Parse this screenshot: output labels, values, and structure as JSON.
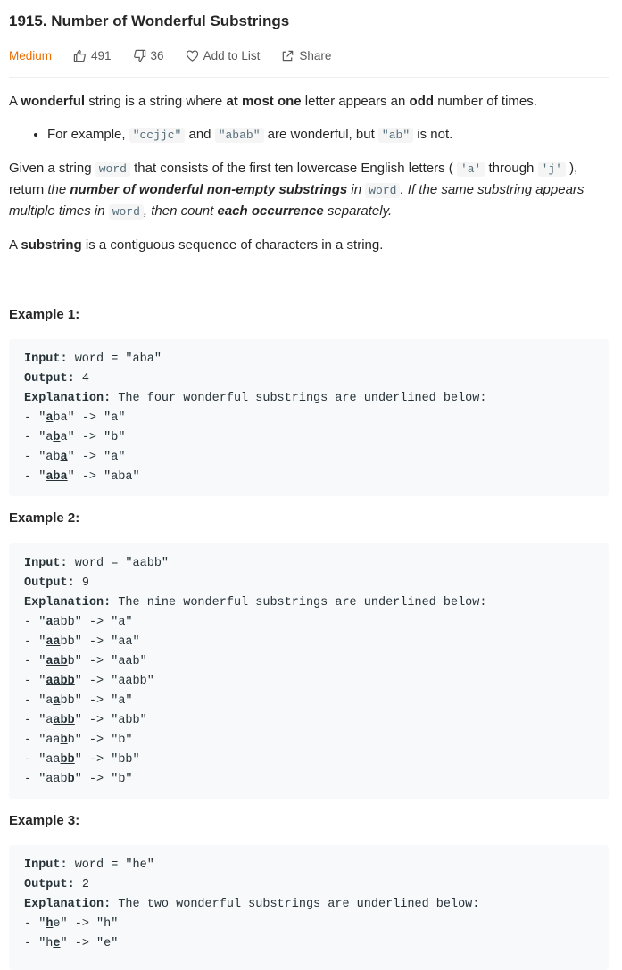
{
  "problem": {
    "title": "1915. Number of Wonderful Substrings",
    "difficulty": "Medium",
    "likes": "491",
    "dislikes": "36",
    "add_to_list": "Add to List",
    "share": "Share"
  },
  "description": {
    "p1": [
      {
        "t": "A "
      },
      {
        "b": "wonderful"
      },
      {
        "t": " string is a string where "
      },
      {
        "b": "at most one"
      },
      {
        "t": " letter appears an "
      },
      {
        "b": "odd"
      },
      {
        "t": " number of times."
      }
    ],
    "bullet": [
      {
        "t": "For example, "
      },
      {
        "c": "\"ccjjc\""
      },
      {
        "t": " and "
      },
      {
        "c": "\"abab\""
      },
      {
        "t": " are wonderful, but "
      },
      {
        "c": "\"ab\""
      },
      {
        "t": " is not."
      }
    ],
    "p2": [
      {
        "t": "Given a string "
      },
      {
        "c": "word"
      },
      {
        "t": " that consists of the first ten lowercase English letters ( "
      },
      {
        "c": "'a'"
      },
      {
        "t": " through "
      },
      {
        "c": "'j'"
      },
      {
        "t": " ), return "
      },
      {
        "i": "the "
      },
      {
        "bi": "number of wonderful non-empty substrings"
      },
      {
        "i": " in "
      },
      {
        "c": "word"
      },
      {
        "i": ". If the same substring appears multiple times in "
      },
      {
        "c": "word"
      },
      {
        "i": ", then count "
      },
      {
        "bi": "each occurrence"
      },
      {
        "i": " separately."
      }
    ],
    "p3": [
      {
        "t": "A "
      },
      {
        "b": "substring"
      },
      {
        "t": " is a contiguous sequence of characters in a string."
      }
    ]
  },
  "examples": [
    {
      "heading": "Example 1:",
      "input_label": "Input:",
      "input": " word = \"aba\"",
      "output_label": "Output:",
      "output": " 4",
      "explanation_label": "Explanation:",
      "explanation": " The four wonderful substrings are underlined below:",
      "lines": [
        {
          "pre": "- \"",
          "u": "a",
          "post": "ba\" -> \"a\""
        },
        {
          "pre": "- \"a",
          "u": "b",
          "post": "a\" -> \"b\""
        },
        {
          "pre": "- \"ab",
          "u": "a",
          "post": "\" -> \"a\""
        },
        {
          "pre": "- \"",
          "u": "aba",
          "post": "\" -> \"aba\""
        }
      ]
    },
    {
      "heading": "Example 2:",
      "input_label": "Input:",
      "input": " word = \"aabb\"",
      "output_label": "Output:",
      "output": " 9",
      "explanation_label": "Explanation:",
      "explanation": " The nine wonderful substrings are underlined below:",
      "lines": [
        {
          "pre": "- \"",
          "u": "a",
          "post": "abb\" -> \"a\""
        },
        {
          "pre": "- \"",
          "u": "aa",
          "post": "bb\" -> \"aa\""
        },
        {
          "pre": "- \"",
          "u": "aab",
          "post": "b\" -> \"aab\""
        },
        {
          "pre": "- \"",
          "u": "aabb",
          "post": "\" -> \"aabb\""
        },
        {
          "pre": "- \"a",
          "u": "a",
          "post": "bb\" -> \"a\""
        },
        {
          "pre": "- \"a",
          "u": "abb",
          "post": "\" -> \"abb\""
        },
        {
          "pre": "- \"aa",
          "u": "b",
          "post": "b\" -> \"b\""
        },
        {
          "pre": "- \"aa",
          "u": "bb",
          "post": "\" -> \"bb\""
        },
        {
          "pre": "- \"aab",
          "u": "b",
          "post": "\" -> \"b\""
        }
      ]
    },
    {
      "heading": "Example 3:",
      "input_label": "Input:",
      "input": " word = \"he\"",
      "output_label": "Output:",
      "output": " 2",
      "explanation_label": "Explanation:",
      "explanation": " The two wonderful substrings are underlined below:",
      "lines": [
        {
          "pre": "- \"",
          "u": "h",
          "post": "e\" -> \"h\""
        },
        {
          "pre": "- \"h",
          "u": "e",
          "post": "\" -> \"e\""
        }
      ]
    }
  ]
}
